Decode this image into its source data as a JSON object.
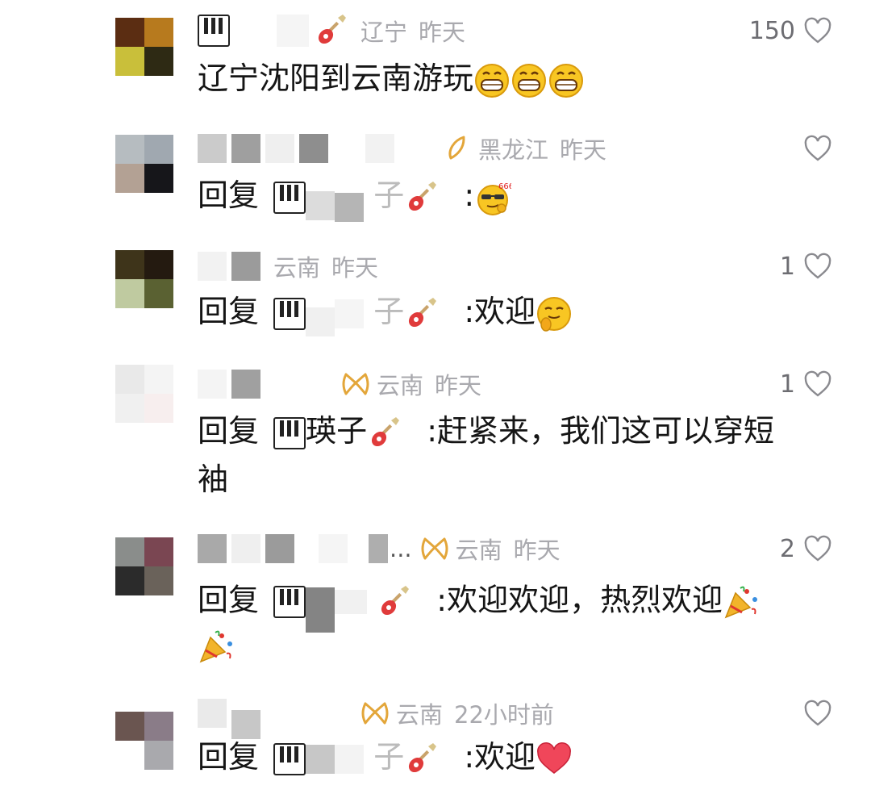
{
  "comments": [
    {
      "region": "辽宁",
      "time": "昨天",
      "likes": "150",
      "text": "辽宁沈阳到云南游玩",
      "avatar_colors": [
        "#5b2d12",
        "#b77a1e",
        "#c9bf3a",
        "#2e2a14"
      ]
    },
    {
      "region": "黑龙江",
      "time": "昨天",
      "likes": "",
      "reply_prefix": "回复",
      "reply_name_suffix": "子",
      "sep": ":",
      "text": "",
      "avatar_colors": [
        "#b6bcc0",
        "#a0a8b0",
        "#b3a194",
        "#16161a"
      ]
    },
    {
      "region": "云南",
      "time": "昨天",
      "likes": "1",
      "reply_prefix": "回复",
      "reply_name_suffix": "子",
      "sep": ":",
      "text": "欢迎",
      "avatar_colors": [
        "#3e341a",
        "#241a10",
        "#bfcaa0",
        "#5a6132"
      ]
    },
    {
      "region": "云南",
      "time": "昨天",
      "likes": "1",
      "reply_prefix": "回复",
      "reply_name_suffix": "瑛子",
      "sep": ":",
      "text_line1": "赶紧来，我们这可以穿短",
      "text_line2": "袖",
      "avatar_colors": [
        "#e9e9e9",
        "#f4f4f4",
        "#f0f0f0",
        "#f7eeee"
      ]
    },
    {
      "region": "云南",
      "time": "昨天",
      "likes": "2",
      "ellipsis": "...",
      "reply_prefix": "回复",
      "sep": ":",
      "text": "欢迎欢迎，热烈欢迎",
      "avatar_colors": [
        "#8a8d8b",
        "#7a4652",
        "#2b2b2b",
        "#6a625a"
      ]
    },
    {
      "region": "云南",
      "time": "22小时前",
      "likes": "",
      "reply_prefix": "回复",
      "reply_name_suffix": "子",
      "sep": ":",
      "text": "欢迎",
      "avatar_colors": [
        "#6a5550",
        "#8a7c88",
        "#ffffff",
        "#a9a9ad"
      ]
    }
  ],
  "icons": {
    "like": "heart-outline-icon",
    "location": "ip-location-icon",
    "name_badge_1": "piano-icon",
    "name_badge_2": "guitar-icon"
  }
}
